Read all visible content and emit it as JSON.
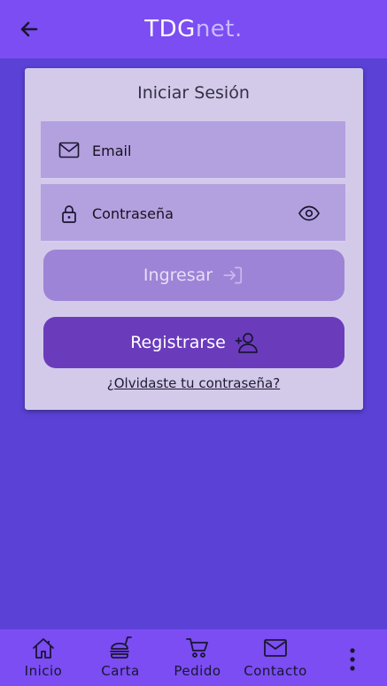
{
  "header": {
    "brand_primary": "TDG",
    "brand_secondary": "net.",
    "back_icon": "arrow-left-icon"
  },
  "login": {
    "title": "Iniciar Sesión",
    "email_label": "Email",
    "password_label": "Contraseña",
    "ingresar_label": "Ingresar",
    "registrarse_label": "Registrarse",
    "forgot_label": "¿Olvidaste tu contraseña?"
  },
  "nav": {
    "items": [
      {
        "label": "Inicio",
        "icon": "home-icon"
      },
      {
        "label": "Carta",
        "icon": "menu-burger-icon"
      },
      {
        "label": "Pedido",
        "icon": "cart-icon"
      },
      {
        "label": "Contacto",
        "icon": "mail-icon"
      }
    ],
    "more_icon": "more-vertical-icon"
  },
  "colors": {
    "topbar": "#7b4df2",
    "background": "#5b41d6",
    "card": "#d3caea",
    "field": "#b3a0df",
    "ingresar_button": "#9e84d6",
    "registrarse_button": "#6a3cbc"
  }
}
